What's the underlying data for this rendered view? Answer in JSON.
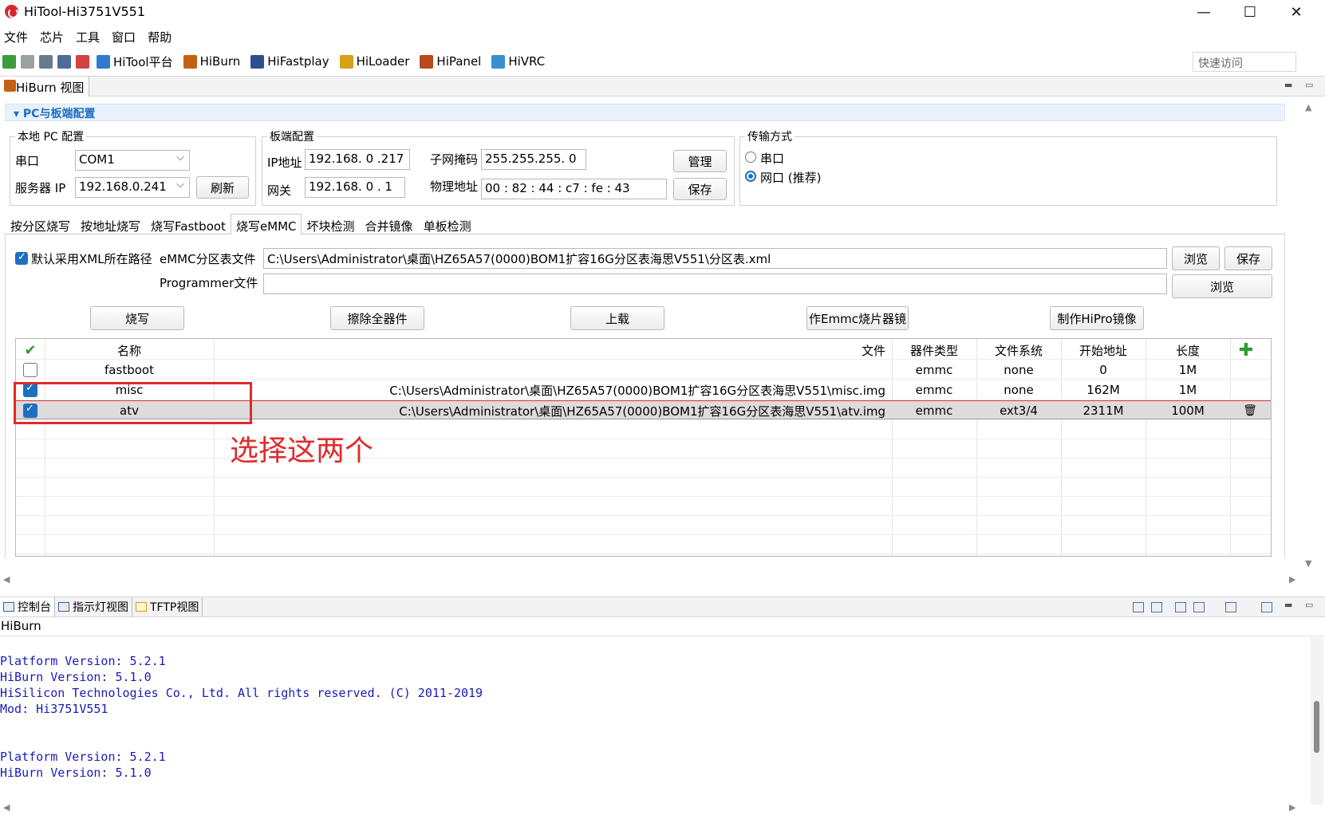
{
  "window": {
    "title": "HiTool-Hi3751V551",
    "min_glyph": "—",
    "max_glyph": "☐",
    "close_glyph": "✕"
  },
  "menu": [
    "文件",
    "芯片",
    "工具",
    "窗口",
    "帮助"
  ],
  "toolbar": {
    "items": [
      {
        "label": "HiTool平台",
        "icon": "home-icon",
        "color": "#2f7bd0"
      },
      {
        "label": "HiBurn",
        "icon": "hiburn-icon",
        "color": "#c46016"
      },
      {
        "label": "HiFastplay",
        "icon": "hifastplay-icon",
        "color": "#2e4f8f"
      },
      {
        "label": "HiLoader",
        "icon": "hiloader-icon",
        "color": "#d6a21a"
      },
      {
        "label": "HiPanel",
        "icon": "hipanel-icon",
        "color": "#b8491a"
      },
      {
        "label": "HiVRC",
        "icon": "hivrc-icon",
        "color": "#3b8fd0"
      }
    ],
    "quick_access_placeholder": "快速访问"
  },
  "view_tab": {
    "label": "HiBurn 视图"
  },
  "section": {
    "title": "PC与板端配置"
  },
  "local_pc": {
    "group_label": "本地 PC 配置",
    "serial_label": "串口",
    "serial_value": "COM1",
    "server_ip_label": "服务器 IP",
    "server_ip_value": "192.168.0.241",
    "refresh_label": "刷新"
  },
  "board": {
    "group_label": "板端配置",
    "ip_label": "IP地址",
    "ip_value": "192.168. 0 .217",
    "mask_label": "子网掩码",
    "mask_value": "255.255.255. 0",
    "gateway_label": "网关",
    "gateway_value": "192.168. 0 . 1",
    "mac_label": "物理地址",
    "mac_value": "00 : 82 : 44 : c7 : fe : 43",
    "manage_label": "管理",
    "save_label": "保存"
  },
  "transfer": {
    "group_label": "传输方式",
    "serial_option": "串口",
    "net_option": "网口 (推荐)",
    "selected": "网口 (推荐)"
  },
  "tabs": [
    "按分区烧写",
    "按地址烧写",
    "烧写Fastboot",
    "烧写eMMC",
    "坏块检测",
    "合并镜像",
    "单板检测"
  ],
  "active_tab": "烧写eMMC",
  "emmc": {
    "default_xml_label": "默认采用XML所在路径",
    "default_xml_checked": true,
    "table_file_label": "eMMC分区表文件",
    "table_file_value": "C:\\Users\\Administrator\\桌面\\HZ65A57(0000)BOM1扩容16G分区表海思V551\\分区表.xml",
    "browse_label": "浏览",
    "save_label": "保存",
    "programmer_label": "Programmer文件",
    "programmer_value": "",
    "browse2_label": "浏览",
    "actions": {
      "burn": "烧写",
      "erase_all": "擦除全器件",
      "upload": "上载",
      "make_emmc_image": "作Emmc烧片器镜",
      "make_hipro_image": "制作HiPro镜像"
    }
  },
  "partition_table": {
    "headers": {
      "name": "名称",
      "file": "文件",
      "device_type": "器件类型",
      "fs": "文件系统",
      "start": "开始地址",
      "length": "长度"
    },
    "rows": [
      {
        "checked": false,
        "name": "fastboot",
        "file": "",
        "device_type": "emmc",
        "fs": "none",
        "start": "0",
        "length": "1M"
      },
      {
        "checked": true,
        "name": "misc",
        "file": "C:\\Users\\Administrator\\桌面\\HZ65A57(0000)BOM1扩容16G分区表海思V551\\misc.img",
        "device_type": "emmc",
        "fs": "none",
        "start": "162M",
        "length": "1M"
      },
      {
        "checked": true,
        "name": "atv",
        "file": "C:\\Users\\Administrator\\桌面\\HZ65A57(0000)BOM1扩容16G分区表海思V551\\atv.img",
        "device_type": "emmc",
        "fs": "ext3/4",
        "start": "2311M",
        "length": "100M"
      }
    ]
  },
  "annotation": {
    "text": "选择这两个",
    "color": "#e02a2a"
  },
  "bottom_tabs": [
    "控制台",
    "指示灯视图",
    "TFTP视图"
  ],
  "console": {
    "label": "HiBurn",
    "lines": [
      "",
      "Platform Version: 5.2.1",
      "HiBurn Version: 5.1.0",
      "HiSilicon Technologies Co., Ltd. All rights reserved. (C) 2011-2019",
      "Mod: Hi3751V551",
      "",
      "",
      "Platform Version: 5.2.1",
      "HiBurn Version: 5.1.0"
    ]
  }
}
